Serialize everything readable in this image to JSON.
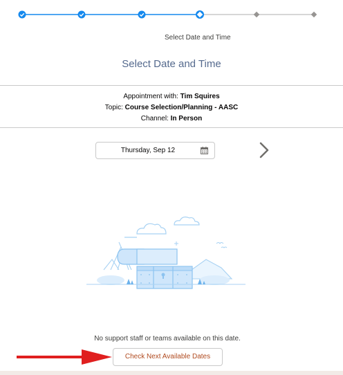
{
  "progress": {
    "total_steps": 6,
    "completed_steps": 3,
    "current_step": 4
  },
  "step_label": "Select Date and Time",
  "page_title": "Select Date and Time",
  "appointment": {
    "with_label": "Appointment with:",
    "with_value": "Tim Squires",
    "topic_label": "Topic:",
    "topic_value": "Course Selection/Planning - AASC",
    "channel_label": "Channel:",
    "channel_value": "In Person"
  },
  "date_picker": {
    "value": "Thursday, Sep 12",
    "icon": "calendar-icon"
  },
  "next_date_icon": "chevron-right-icon",
  "empty_state": {
    "message": "No support staff or teams available on this date.",
    "button_label": "Check Next Available Dates"
  },
  "colors": {
    "accent": "#1589ee",
    "button_text": "#b04a1f",
    "annotation_arrow": "#e01f1f"
  }
}
